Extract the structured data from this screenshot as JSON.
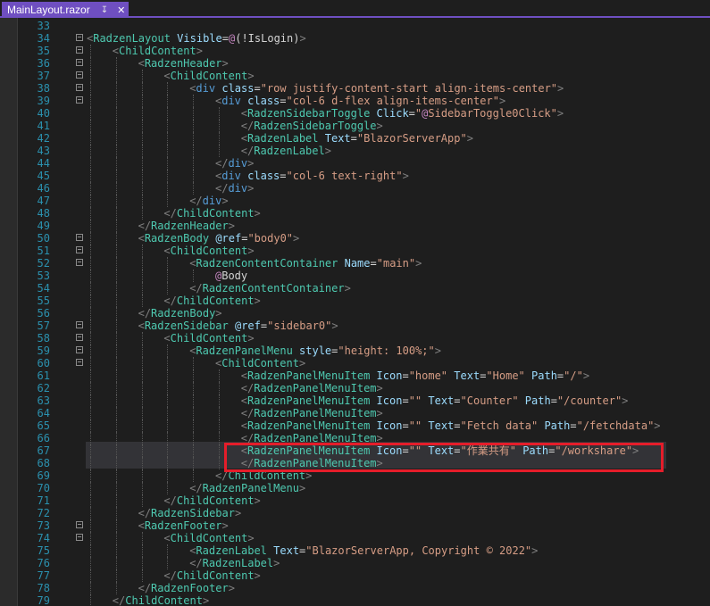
{
  "tab": {
    "title": "MainLayout.razor",
    "pin_glyph": "↧",
    "close_glyph": "✕"
  },
  "colors": {
    "accent": "#6f4fc1",
    "highlight_box": "#e51d2a",
    "line_number": "#2b91af",
    "component": "#4ec9b0",
    "attribute": "#9cdcfe",
    "string": "#d69d85",
    "element": "#569cd6"
  },
  "editor": {
    "highlighted_lines": [
      67,
      68
    ],
    "lines": [
      {
        "n": "33",
        "fold": false,
        "indent": 0,
        "tokens": []
      },
      {
        "n": "34",
        "fold": true,
        "indent": 0,
        "tokens": [
          [
            "t",
            "<"
          ],
          [
            "c",
            "RadzenLayout"
          ],
          [
            "d",
            " "
          ],
          [
            "a",
            "Visible"
          ],
          [
            "d",
            "="
          ],
          [
            "r",
            "@"
          ],
          [
            "d",
            "(!IsLogin)"
          ],
          [
            "t",
            ">"
          ]
        ]
      },
      {
        "n": "35",
        "fold": true,
        "indent": 1,
        "tokens": [
          [
            "t",
            "<"
          ],
          [
            "c",
            "ChildContent"
          ],
          [
            "t",
            ">"
          ]
        ]
      },
      {
        "n": "36",
        "fold": true,
        "indent": 2,
        "tokens": [
          [
            "t",
            "<"
          ],
          [
            "c",
            "RadzenHeader"
          ],
          [
            "t",
            ">"
          ]
        ]
      },
      {
        "n": "37",
        "fold": true,
        "indent": 3,
        "tokens": [
          [
            "t",
            "<"
          ],
          [
            "c",
            "ChildContent"
          ],
          [
            "t",
            ">"
          ]
        ]
      },
      {
        "n": "38",
        "fold": true,
        "indent": 4,
        "tokens": [
          [
            "t",
            "<"
          ],
          [
            "e",
            "div"
          ],
          [
            "d",
            " "
          ],
          [
            "a",
            "class"
          ],
          [
            "d",
            "="
          ],
          [
            "s",
            "\"row justify-content-start align-items-center\""
          ],
          [
            "t",
            ">"
          ]
        ]
      },
      {
        "n": "39",
        "fold": true,
        "indent": 5,
        "tokens": [
          [
            "t",
            "<"
          ],
          [
            "e",
            "div"
          ],
          [
            "d",
            " "
          ],
          [
            "a",
            "class"
          ],
          [
            "d",
            "="
          ],
          [
            "s",
            "\"col-6 d-flex align-items-center\""
          ],
          [
            "t",
            ">"
          ]
        ]
      },
      {
        "n": "40",
        "fold": false,
        "indent": 6,
        "tokens": [
          [
            "t",
            "<"
          ],
          [
            "c",
            "RadzenSidebarToggle"
          ],
          [
            "d",
            " "
          ],
          [
            "a",
            "Click"
          ],
          [
            "d",
            "="
          ],
          [
            "s",
            "\""
          ],
          [
            "r",
            "@"
          ],
          [
            "s",
            "SidebarToggle0Click\""
          ],
          [
            "t",
            ">"
          ]
        ]
      },
      {
        "n": "41",
        "fold": false,
        "indent": 6,
        "tokens": [
          [
            "t",
            "</"
          ],
          [
            "c",
            "RadzenSidebarToggle"
          ],
          [
            "t",
            ">"
          ]
        ]
      },
      {
        "n": "42",
        "fold": false,
        "indent": 6,
        "tokens": [
          [
            "t",
            "<"
          ],
          [
            "c",
            "RadzenLabel"
          ],
          [
            "d",
            " "
          ],
          [
            "a",
            "Text"
          ],
          [
            "d",
            "="
          ],
          [
            "s",
            "\"BlazorServerApp\""
          ],
          [
            "t",
            ">"
          ]
        ]
      },
      {
        "n": "43",
        "fold": false,
        "indent": 6,
        "tokens": [
          [
            "t",
            "</"
          ],
          [
            "c",
            "RadzenLabel"
          ],
          [
            "t",
            ">"
          ]
        ]
      },
      {
        "n": "44",
        "fold": false,
        "indent": 5,
        "tokens": [
          [
            "t",
            "</"
          ],
          [
            "e",
            "div"
          ],
          [
            "t",
            ">"
          ]
        ]
      },
      {
        "n": "45",
        "fold": false,
        "indent": 5,
        "tokens": [
          [
            "t",
            "<"
          ],
          [
            "e",
            "div"
          ],
          [
            "d",
            " "
          ],
          [
            "a",
            "class"
          ],
          [
            "d",
            "="
          ],
          [
            "s",
            "\"col-6 text-right\""
          ],
          [
            "t",
            ">"
          ]
        ]
      },
      {
        "n": "46",
        "fold": false,
        "indent": 5,
        "tokens": [
          [
            "t",
            "</"
          ],
          [
            "e",
            "div"
          ],
          [
            "t",
            ">"
          ]
        ]
      },
      {
        "n": "47",
        "fold": false,
        "indent": 4,
        "tokens": [
          [
            "t",
            "</"
          ],
          [
            "e",
            "div"
          ],
          [
            "t",
            ">"
          ]
        ]
      },
      {
        "n": "48",
        "fold": false,
        "indent": 3,
        "tokens": [
          [
            "t",
            "</"
          ],
          [
            "c",
            "ChildContent"
          ],
          [
            "t",
            ">"
          ]
        ]
      },
      {
        "n": "49",
        "fold": false,
        "indent": 2,
        "tokens": [
          [
            "t",
            "</"
          ],
          [
            "c",
            "RadzenHeader"
          ],
          [
            "t",
            ">"
          ]
        ]
      },
      {
        "n": "50",
        "fold": true,
        "indent": 2,
        "tokens": [
          [
            "t",
            "<"
          ],
          [
            "c",
            "RadzenBody"
          ],
          [
            "d",
            " "
          ],
          [
            "a",
            "@ref"
          ],
          [
            "d",
            "="
          ],
          [
            "s",
            "\"body0\""
          ],
          [
            "t",
            ">"
          ]
        ]
      },
      {
        "n": "51",
        "fold": true,
        "indent": 3,
        "tokens": [
          [
            "t",
            "<"
          ],
          [
            "c",
            "ChildContent"
          ],
          [
            "t",
            ">"
          ]
        ]
      },
      {
        "n": "52",
        "fold": true,
        "indent": 4,
        "tokens": [
          [
            "t",
            "<"
          ],
          [
            "c",
            "RadzenContentContainer"
          ],
          [
            "d",
            " "
          ],
          [
            "a",
            "Name"
          ],
          [
            "d",
            "="
          ],
          [
            "s",
            "\"main\""
          ],
          [
            "t",
            ">"
          ]
        ]
      },
      {
        "n": "53",
        "fold": false,
        "indent": 5,
        "tokens": [
          [
            "r",
            "@"
          ],
          [
            "d",
            "Body"
          ]
        ]
      },
      {
        "n": "54",
        "fold": false,
        "indent": 4,
        "tokens": [
          [
            "t",
            "</"
          ],
          [
            "c",
            "RadzenContentContainer"
          ],
          [
            "t",
            ">"
          ]
        ]
      },
      {
        "n": "55",
        "fold": false,
        "indent": 3,
        "tokens": [
          [
            "t",
            "</"
          ],
          [
            "c",
            "ChildContent"
          ],
          [
            "t",
            ">"
          ]
        ]
      },
      {
        "n": "56",
        "fold": false,
        "indent": 2,
        "tokens": [
          [
            "t",
            "</"
          ],
          [
            "c",
            "RadzenBody"
          ],
          [
            "t",
            ">"
          ]
        ]
      },
      {
        "n": "57",
        "fold": true,
        "indent": 2,
        "tokens": [
          [
            "t",
            "<"
          ],
          [
            "c",
            "RadzenSidebar"
          ],
          [
            "d",
            " "
          ],
          [
            "a",
            "@ref"
          ],
          [
            "d",
            "="
          ],
          [
            "s",
            "\"sidebar0\""
          ],
          [
            "t",
            ">"
          ]
        ]
      },
      {
        "n": "58",
        "fold": true,
        "indent": 3,
        "tokens": [
          [
            "t",
            "<"
          ],
          [
            "c",
            "ChildContent"
          ],
          [
            "t",
            ">"
          ]
        ]
      },
      {
        "n": "59",
        "fold": true,
        "indent": 4,
        "tokens": [
          [
            "t",
            "<"
          ],
          [
            "c",
            "RadzenPanelMenu"
          ],
          [
            "d",
            " "
          ],
          [
            "a",
            "style"
          ],
          [
            "d",
            "="
          ],
          [
            "s",
            "\"height: 100%;\""
          ],
          [
            "t",
            ">"
          ]
        ]
      },
      {
        "n": "60",
        "fold": true,
        "indent": 5,
        "tokens": [
          [
            "t",
            "<"
          ],
          [
            "c",
            "ChildContent"
          ],
          [
            "t",
            ">"
          ]
        ]
      },
      {
        "n": "61",
        "fold": false,
        "indent": 6,
        "tokens": [
          [
            "t",
            "<"
          ],
          [
            "c",
            "RadzenPanelMenuItem"
          ],
          [
            "d",
            " "
          ],
          [
            "a",
            "Icon"
          ],
          [
            "d",
            "="
          ],
          [
            "s",
            "\"home\""
          ],
          [
            "d",
            " "
          ],
          [
            "a",
            "Text"
          ],
          [
            "d",
            "="
          ],
          [
            "s",
            "\"Home\""
          ],
          [
            "d",
            " "
          ],
          [
            "a",
            "Path"
          ],
          [
            "d",
            "="
          ],
          [
            "s",
            "\"/\""
          ],
          [
            "t",
            ">"
          ]
        ]
      },
      {
        "n": "62",
        "fold": false,
        "indent": 6,
        "tokens": [
          [
            "t",
            "</"
          ],
          [
            "c",
            "RadzenPanelMenuItem"
          ],
          [
            "t",
            ">"
          ]
        ]
      },
      {
        "n": "63",
        "fold": false,
        "indent": 6,
        "tokens": [
          [
            "t",
            "<"
          ],
          [
            "c",
            "RadzenPanelMenuItem"
          ],
          [
            "d",
            " "
          ],
          [
            "a",
            "Icon"
          ],
          [
            "d",
            "="
          ],
          [
            "s",
            "\"\""
          ],
          [
            "d",
            " "
          ],
          [
            "a",
            "Text"
          ],
          [
            "d",
            "="
          ],
          [
            "s",
            "\"Counter\""
          ],
          [
            "d",
            " "
          ],
          [
            "a",
            "Path"
          ],
          [
            "d",
            "="
          ],
          [
            "s",
            "\"/counter\""
          ],
          [
            "t",
            ">"
          ]
        ]
      },
      {
        "n": "64",
        "fold": false,
        "indent": 6,
        "tokens": [
          [
            "t",
            "</"
          ],
          [
            "c",
            "RadzenPanelMenuItem"
          ],
          [
            "t",
            ">"
          ]
        ]
      },
      {
        "n": "65",
        "fold": false,
        "indent": 6,
        "tokens": [
          [
            "t",
            "<"
          ],
          [
            "c",
            "RadzenPanelMenuItem"
          ],
          [
            "d",
            " "
          ],
          [
            "a",
            "Icon"
          ],
          [
            "d",
            "="
          ],
          [
            "s",
            "\"\""
          ],
          [
            "d",
            " "
          ],
          [
            "a",
            "Text"
          ],
          [
            "d",
            "="
          ],
          [
            "s",
            "\"Fetch data\""
          ],
          [
            "d",
            " "
          ],
          [
            "a",
            "Path"
          ],
          [
            "d",
            "="
          ],
          [
            "s",
            "\"/fetchdata\""
          ],
          [
            "t",
            ">"
          ]
        ]
      },
      {
        "n": "66",
        "fold": false,
        "indent": 6,
        "tokens": [
          [
            "t",
            "</"
          ],
          [
            "c",
            "RadzenPanelMenuItem"
          ],
          [
            "t",
            ">"
          ]
        ]
      },
      {
        "n": "67",
        "fold": false,
        "indent": 6,
        "tokens": [
          [
            "t",
            "<"
          ],
          [
            "c",
            "RadzenPanelMenuItem"
          ],
          [
            "d",
            " "
          ],
          [
            "a",
            "Icon"
          ],
          [
            "d",
            "="
          ],
          [
            "s",
            "\"\""
          ],
          [
            "d",
            " "
          ],
          [
            "a",
            "Text"
          ],
          [
            "d",
            "="
          ],
          [
            "s",
            "\"作業共有\""
          ],
          [
            "d",
            " "
          ],
          [
            "a",
            "Path"
          ],
          [
            "d",
            "="
          ],
          [
            "s",
            "\"/workshare\""
          ],
          [
            "t",
            ">"
          ]
        ]
      },
      {
        "n": "68",
        "fold": false,
        "indent": 6,
        "tokens": [
          [
            "t",
            "</"
          ],
          [
            "c",
            "RadzenPanelMenuItem"
          ],
          [
            "t",
            ">"
          ]
        ]
      },
      {
        "n": "69",
        "fold": false,
        "indent": 5,
        "tokens": [
          [
            "t",
            "</"
          ],
          [
            "c",
            "ChildContent"
          ],
          [
            "t",
            ">"
          ]
        ]
      },
      {
        "n": "70",
        "fold": false,
        "indent": 4,
        "tokens": [
          [
            "t",
            "</"
          ],
          [
            "c",
            "RadzenPanelMenu"
          ],
          [
            "t",
            ">"
          ]
        ]
      },
      {
        "n": "71",
        "fold": false,
        "indent": 3,
        "tokens": [
          [
            "t",
            "</"
          ],
          [
            "c",
            "ChildContent"
          ],
          [
            "t",
            ">"
          ]
        ]
      },
      {
        "n": "72",
        "fold": false,
        "indent": 2,
        "tokens": [
          [
            "t",
            "</"
          ],
          [
            "c",
            "RadzenSidebar"
          ],
          [
            "t",
            ">"
          ]
        ]
      },
      {
        "n": "73",
        "fold": true,
        "indent": 2,
        "tokens": [
          [
            "t",
            "<"
          ],
          [
            "c",
            "RadzenFooter"
          ],
          [
            "t",
            ">"
          ]
        ]
      },
      {
        "n": "74",
        "fold": true,
        "indent": 3,
        "tokens": [
          [
            "t",
            "<"
          ],
          [
            "c",
            "ChildContent"
          ],
          [
            "t",
            ">"
          ]
        ]
      },
      {
        "n": "75",
        "fold": false,
        "indent": 4,
        "tokens": [
          [
            "t",
            "<"
          ],
          [
            "c",
            "RadzenLabel"
          ],
          [
            "d",
            " "
          ],
          [
            "a",
            "Text"
          ],
          [
            "d",
            "="
          ],
          [
            "s",
            "\"BlazorServerApp, Copyright © 2022\""
          ],
          [
            "t",
            ">"
          ]
        ]
      },
      {
        "n": "76",
        "fold": false,
        "indent": 4,
        "tokens": [
          [
            "t",
            "</"
          ],
          [
            "c",
            "RadzenLabel"
          ],
          [
            "t",
            ">"
          ]
        ]
      },
      {
        "n": "77",
        "fold": false,
        "indent": 3,
        "tokens": [
          [
            "t",
            "</"
          ],
          [
            "c",
            "ChildContent"
          ],
          [
            "t",
            ">"
          ]
        ]
      },
      {
        "n": "78",
        "fold": false,
        "indent": 2,
        "tokens": [
          [
            "t",
            "</"
          ],
          [
            "c",
            "RadzenFooter"
          ],
          [
            "t",
            ">"
          ]
        ]
      },
      {
        "n": "79",
        "fold": false,
        "indent": 1,
        "tokens": [
          [
            "t",
            "</"
          ],
          [
            "c",
            "ChildContent"
          ],
          [
            "t",
            ">"
          ]
        ]
      }
    ]
  }
}
